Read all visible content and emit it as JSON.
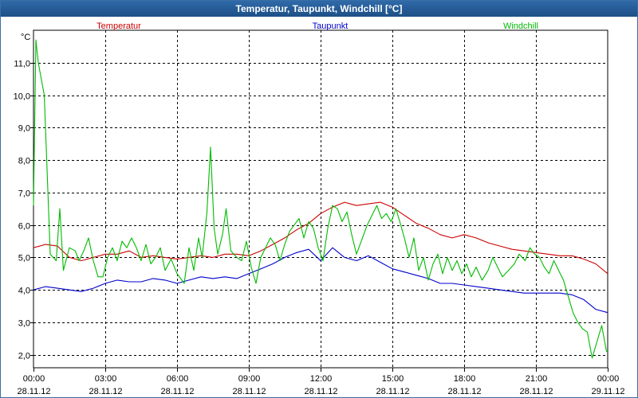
{
  "window": {
    "title": "Temperatur, Taupunkt, Windchill [°C]"
  },
  "chart_data": {
    "type": "line",
    "title": "Temperatur, Taupunkt, Windchill [°C]",
    "ylabel": "°C",
    "ylim": [
      1.6,
      12.0
    ],
    "yticks": [
      2.0,
      3.0,
      4.0,
      5.0,
      6.0,
      7.0,
      8.0,
      9.0,
      10.0,
      11.0
    ],
    "ytick_labels": [
      "2,0",
      "3,0",
      "4,0",
      "5,0",
      "6,0",
      "7,0",
      "8,0",
      "9,0",
      "10,0",
      "11,0"
    ],
    "xlim": [
      0,
      24
    ],
    "xticks": [
      0,
      3,
      6,
      9,
      12,
      15,
      18,
      21,
      24
    ],
    "xtick_time": [
      "00:00",
      "03:00",
      "06:00",
      "09:00",
      "12:00",
      "15:00",
      "18:00",
      "21:00",
      "00:00"
    ],
    "xtick_date": [
      "28.11.12",
      "28.11.12",
      "28.11.12",
      "28.11.12",
      "28.11.12",
      "28.11.12",
      "28.11.12",
      "28.11.12",
      "29.11.12"
    ],
    "x_unit": "hours since 28.11.12 00:00",
    "grid": true,
    "legend_position": "top",
    "series": [
      {
        "name": "Temperatur",
        "color": "#cc0000",
        "points": [
          [
            0,
            5.3
          ],
          [
            0.5,
            5.4
          ],
          [
            1,
            5.35
          ],
          [
            1.5,
            5.0
          ],
          [
            2,
            4.9
          ],
          [
            2.5,
            5.0
          ],
          [
            3,
            5.1
          ],
          [
            3.5,
            5.1
          ],
          [
            4,
            5.2
          ],
          [
            4.5,
            5.0
          ],
          [
            5,
            5.05
          ],
          [
            5.5,
            5.0
          ],
          [
            6,
            4.95
          ],
          [
            6.5,
            5.0
          ],
          [
            7,
            5.05
          ],
          [
            7.5,
            5.0
          ],
          [
            8,
            5.1
          ],
          [
            8.5,
            5.1
          ],
          [
            9,
            5.05
          ],
          [
            9.5,
            5.2
          ],
          [
            10,
            5.4
          ],
          [
            10.5,
            5.6
          ],
          [
            11,
            5.85
          ],
          [
            11.5,
            6.05
          ],
          [
            12,
            6.35
          ],
          [
            12.5,
            6.55
          ],
          [
            13,
            6.7
          ],
          [
            13.5,
            6.6
          ],
          [
            14,
            6.65
          ],
          [
            14.5,
            6.7
          ],
          [
            15,
            6.55
          ],
          [
            15.5,
            6.3
          ],
          [
            16,
            6.05
          ],
          [
            16.5,
            5.9
          ],
          [
            17,
            5.7
          ],
          [
            17.5,
            5.6
          ],
          [
            18,
            5.7
          ],
          [
            18.5,
            5.6
          ],
          [
            19,
            5.45
          ],
          [
            19.5,
            5.35
          ],
          [
            20,
            5.25
          ],
          [
            20.5,
            5.2
          ],
          [
            21,
            5.15
          ],
          [
            21.5,
            5.1
          ],
          [
            22,
            5.05
          ],
          [
            22.5,
            5.05
          ],
          [
            23,
            4.95
          ],
          [
            23.5,
            4.8
          ],
          [
            24,
            4.5
          ]
        ]
      },
      {
        "name": "Taupunkt",
        "color": "#0000cc",
        "points": [
          [
            0,
            4.0
          ],
          [
            0.5,
            4.1
          ],
          [
            1,
            4.05
          ],
          [
            1.5,
            4.0
          ],
          [
            2,
            3.95
          ],
          [
            2.5,
            4.05
          ],
          [
            3,
            4.2
          ],
          [
            3.5,
            4.3
          ],
          [
            4,
            4.25
          ],
          [
            4.5,
            4.25
          ],
          [
            5,
            4.35
          ],
          [
            5.5,
            4.3
          ],
          [
            6,
            4.2
          ],
          [
            6.5,
            4.3
          ],
          [
            7,
            4.4
          ],
          [
            7.5,
            4.35
          ],
          [
            8,
            4.4
          ],
          [
            8.5,
            4.35
          ],
          [
            9,
            4.5
          ],
          [
            9.5,
            4.65
          ],
          [
            10,
            4.8
          ],
          [
            10.5,
            5.0
          ],
          [
            11,
            5.15
          ],
          [
            11.5,
            5.25
          ],
          [
            12,
            4.9
          ],
          [
            12.5,
            5.3
          ],
          [
            13,
            5.0
          ],
          [
            13.5,
            4.9
          ],
          [
            14,
            5.05
          ],
          [
            14.5,
            4.85
          ],
          [
            15,
            4.65
          ],
          [
            15.5,
            4.55
          ],
          [
            16,
            4.45
          ],
          [
            16.5,
            4.35
          ],
          [
            17,
            4.2
          ],
          [
            17.5,
            4.2
          ],
          [
            18,
            4.15
          ],
          [
            18.5,
            4.1
          ],
          [
            19,
            4.05
          ],
          [
            19.5,
            4.0
          ],
          [
            20,
            3.95
          ],
          [
            20.5,
            3.9
          ],
          [
            21,
            3.9
          ],
          [
            21.5,
            3.9
          ],
          [
            22,
            3.9
          ],
          [
            22.5,
            3.85
          ],
          [
            23,
            3.7
          ],
          [
            23.5,
            3.4
          ],
          [
            24,
            3.3
          ]
        ]
      },
      {
        "name": "Windchill",
        "color": "#00bb00",
        "points": [
          [
            0,
            6.6
          ],
          [
            0.1,
            11.7
          ],
          [
            0.2,
            11.0
          ],
          [
            0.45,
            10.0
          ],
          [
            0.7,
            5.1
          ],
          [
            0.95,
            4.9
          ],
          [
            1.1,
            6.5
          ],
          [
            1.25,
            4.6
          ],
          [
            1.5,
            5.3
          ],
          [
            1.75,
            5.2
          ],
          [
            1.9,
            4.9
          ],
          [
            2.1,
            5.2
          ],
          [
            2.3,
            5.6
          ],
          [
            2.5,
            4.9
          ],
          [
            2.7,
            4.4
          ],
          [
            2.9,
            4.4
          ],
          [
            3.1,
            5.0
          ],
          [
            3.3,
            5.3
          ],
          [
            3.5,
            4.9
          ],
          [
            3.7,
            5.5
          ],
          [
            3.9,
            5.3
          ],
          [
            4.1,
            5.6
          ],
          [
            4.3,
            5.3
          ],
          [
            4.5,
            4.9
          ],
          [
            4.7,
            5.4
          ],
          [
            4.9,
            4.8
          ],
          [
            5.1,
            5.0
          ],
          [
            5.3,
            5.3
          ],
          [
            5.5,
            4.6
          ],
          [
            5.75,
            4.95
          ],
          [
            6.0,
            4.5
          ],
          [
            6.3,
            4.2
          ],
          [
            6.5,
            5.3
          ],
          [
            6.7,
            4.6
          ],
          [
            6.9,
            5.6
          ],
          [
            7.05,
            5.0
          ],
          [
            7.25,
            6.4
          ],
          [
            7.4,
            8.4
          ],
          [
            7.55,
            5.9
          ],
          [
            7.7,
            5.1
          ],
          [
            7.9,
            5.7
          ],
          [
            8.05,
            6.5
          ],
          [
            8.25,
            5.2
          ],
          [
            8.5,
            5.0
          ],
          [
            8.7,
            4.9
          ],
          [
            8.9,
            5.5
          ],
          [
            9.1,
            4.7
          ],
          [
            9.3,
            4.2
          ],
          [
            9.5,
            5.0
          ],
          [
            9.7,
            5.3
          ],
          [
            9.9,
            5.6
          ],
          [
            10.1,
            5.4
          ],
          [
            10.3,
            4.9
          ],
          [
            10.5,
            5.4
          ],
          [
            10.7,
            5.8
          ],
          [
            10.9,
            6.0
          ],
          [
            11.1,
            6.2
          ],
          [
            11.3,
            5.6
          ],
          [
            11.5,
            6.1
          ],
          [
            11.7,
            5.9
          ],
          [
            11.9,
            5.3
          ],
          [
            12.1,
            4.9
          ],
          [
            12.3,
            5.9
          ],
          [
            12.5,
            6.6
          ],
          [
            12.7,
            6.5
          ],
          [
            12.9,
            6.1
          ],
          [
            13.1,
            6.4
          ],
          [
            13.3,
            5.7
          ],
          [
            13.5,
            5.1
          ],
          [
            13.75,
            5.6
          ],
          [
            13.95,
            6.0
          ],
          [
            14.15,
            6.3
          ],
          [
            14.35,
            6.6
          ],
          [
            14.55,
            6.2
          ],
          [
            14.75,
            6.35
          ],
          [
            14.95,
            6.1
          ],
          [
            15.15,
            6.5
          ],
          [
            15.35,
            6.0
          ],
          [
            15.5,
            5.6
          ],
          [
            15.7,
            5.0
          ],
          [
            15.9,
            5.6
          ],
          [
            16.1,
            4.6
          ],
          [
            16.3,
            5.0
          ],
          [
            16.5,
            4.3
          ],
          [
            16.7,
            4.8
          ],
          [
            16.9,
            5.1
          ],
          [
            17.1,
            4.5
          ],
          [
            17.3,
            5.0
          ],
          [
            17.5,
            4.6
          ],
          [
            17.7,
            4.9
          ],
          [
            17.9,
            4.5
          ],
          [
            18.1,
            4.8
          ],
          [
            18.3,
            4.4
          ],
          [
            18.5,
            4.7
          ],
          [
            18.75,
            4.3
          ],
          [
            19.0,
            4.6
          ],
          [
            19.2,
            5.0
          ],
          [
            19.4,
            4.7
          ],
          [
            19.6,
            4.4
          ],
          [
            19.85,
            4.6
          ],
          [
            20.1,
            4.8
          ],
          [
            20.3,
            5.1
          ],
          [
            20.55,
            4.9
          ],
          [
            20.75,
            5.3
          ],
          [
            20.95,
            5.1
          ],
          [
            21.15,
            5.0
          ],
          [
            21.35,
            4.7
          ],
          [
            21.55,
            4.5
          ],
          [
            21.75,
            4.9
          ],
          [
            21.95,
            4.6
          ],
          [
            22.15,
            4.3
          ],
          [
            22.35,
            3.8
          ],
          [
            22.55,
            3.3
          ],
          [
            22.75,
            3.0
          ],
          [
            22.95,
            2.8
          ],
          [
            23.15,
            2.7
          ],
          [
            23.35,
            1.9
          ],
          [
            23.55,
            2.4
          ],
          [
            23.75,
            2.9
          ],
          [
            23.95,
            2.1
          ],
          [
            24,
            2.1
          ]
        ]
      }
    ]
  }
}
